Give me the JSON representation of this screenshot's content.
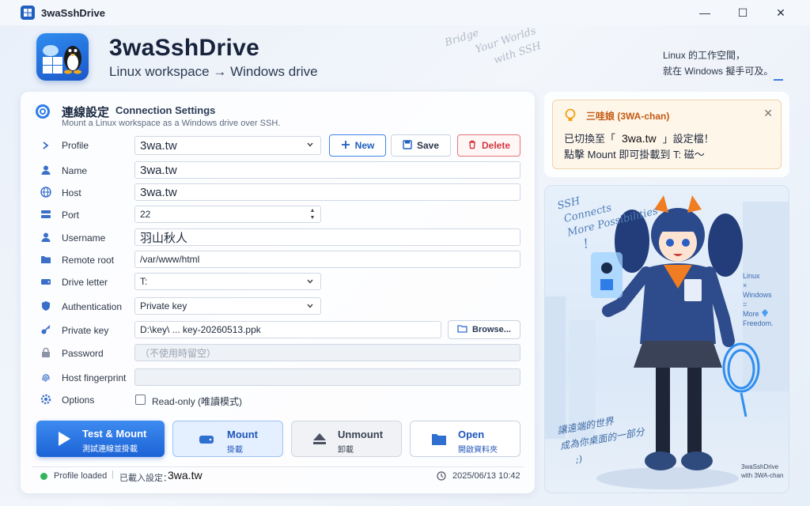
{
  "window": {
    "title": "3waSshDrive",
    "controls": {
      "minimize": "—",
      "maximize": "☐",
      "close": "✕"
    }
  },
  "header": {
    "app_name": "3waSshDrive",
    "tagline": "Linux workspace → Windows drive",
    "handwriting": [
      "Bridge",
      "Your Worlds",
      "with SSH"
    ],
    "note_line1": "Linux 的工作空間，",
    "note_line2": "就在 Windows 擬手可及。"
  },
  "section": {
    "title_zh": "連線設定",
    "title_en": "Connection Settings",
    "subtitle": "Mount a Linux workspace as a Windows drive over SSH."
  },
  "form": {
    "profile": {
      "label": "Profile",
      "value": "3wa.tw"
    },
    "name": {
      "label": "Name",
      "value": "3wa.tw"
    },
    "host": {
      "label": "Host",
      "value": "3wa.tw"
    },
    "port": {
      "label": "Port",
      "value": "22"
    },
    "username": {
      "label": "Username",
      "value": "羽山秋人"
    },
    "remote_root": {
      "label": "Remote root",
      "value": "/var/www/html"
    },
    "drive_letter": {
      "label": "Drive letter",
      "value": "T:"
    },
    "authentication": {
      "label": "Authentication",
      "value": "Private key"
    },
    "private_key": {
      "label": "Private key",
      "value": "D:\\key\\ ... key-20260513.ppk"
    },
    "password": {
      "label": "Password",
      "placeholder": "（不使用時留空）"
    },
    "fingerprint": {
      "label": "Host fingerprint",
      "value": ""
    },
    "options": {
      "label": "Options",
      "readonly_label": "Read-only (唯讀模式)"
    }
  },
  "buttons": {
    "new": "New",
    "save": "Save",
    "delete": "Delete",
    "browse": "Browse..."
  },
  "actions": [
    {
      "main": "Test & Mount",
      "sub": "測試連線並掛載"
    },
    {
      "main": "Mount",
      "sub": "掛載"
    },
    {
      "main": "Unmount",
      "sub": "卸載"
    },
    {
      "main": "Open",
      "sub": "開啟資料夾"
    }
  ],
  "status": {
    "text": "Profile loaded",
    "separator": "|",
    "prefix": "已載入設定：",
    "profile": "3wa.tw",
    "datetime": "2025/06/13 10:42"
  },
  "notification": {
    "title": "三哇娘 (3WA-chan)",
    "line1_prefix": "已切換至「",
    "line1_value": "3wa.tw",
    "line1_suffix": "」設定檔！",
    "line2": "點擊 Mount 即可掛載到 T: 磁～",
    "close": "✕"
  },
  "illustration": {
    "ssh_lines": [
      "SSH",
      "Connects",
      "More Possibilities",
      "!"
    ],
    "side_lines": [
      "Linux",
      "×",
      "Windows",
      "=",
      "More Freedom."
    ],
    "bottom_lines": [
      "讓遠端的世界",
      "成為你桌面的一部分",
      ";)"
    ],
    "signature_line1": "3waSshDrive",
    "signature_line2": "with 3WA-chan"
  },
  "colors": {
    "accent": "#1c63d6",
    "delete": "#d33a44",
    "status_ok": "#34b45c",
    "notif_title": "#c45a12"
  }
}
